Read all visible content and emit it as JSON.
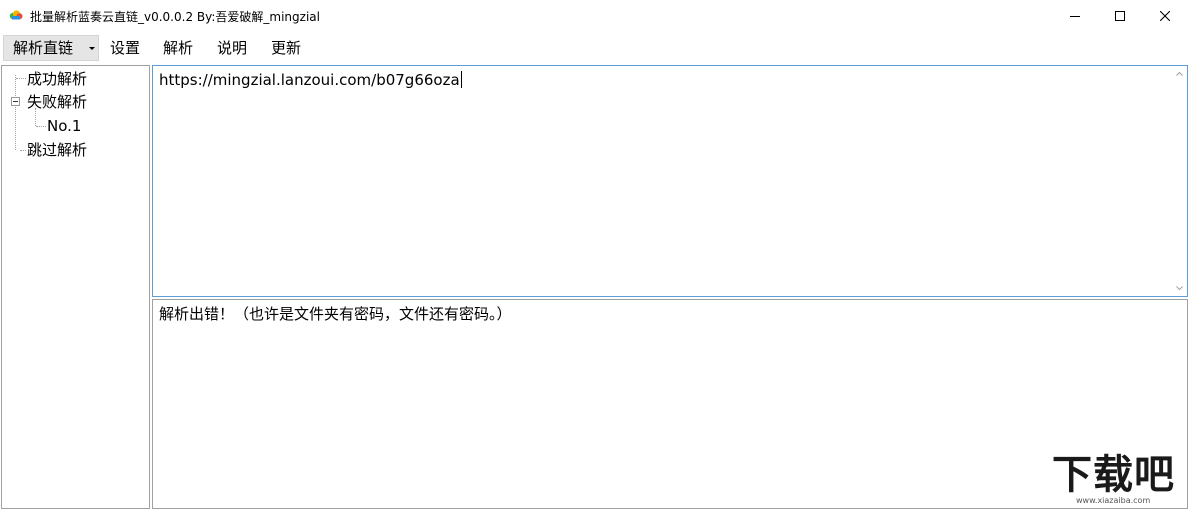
{
  "window": {
    "title": "批量解析蓝奏云直链_v0.0.0.2 By:吾爱破解_mingzial",
    "app_icon": "cloud-icon",
    "controls": {
      "minimize_icon": "minimize-icon",
      "maximize_icon": "maximize-icon",
      "close_icon": "close-icon"
    }
  },
  "menu": {
    "split_button_label": "解析直链",
    "items": [
      "设置",
      "解析",
      "说明",
      "更新"
    ]
  },
  "tree": {
    "nodes": [
      {
        "label": "成功解析"
      },
      {
        "label": "失败解析",
        "expanded": true,
        "children": [
          {
            "label": "No.1"
          }
        ]
      },
      {
        "label": "跳过解析"
      }
    ]
  },
  "url_input": {
    "value": "https://mingzial.lanzoui.com/b07g66oza"
  },
  "result": {
    "text": "解析出错！（也许是文件夹有密码，文件还有密码。）"
  },
  "watermark": {
    "main": "下载吧",
    "sub": "www.xiazaiba.com"
  },
  "colors": {
    "focus_border": "#5e9ed6",
    "menu_highlight": "#e5e5e5",
    "panel_border": "#a0a0a0"
  }
}
